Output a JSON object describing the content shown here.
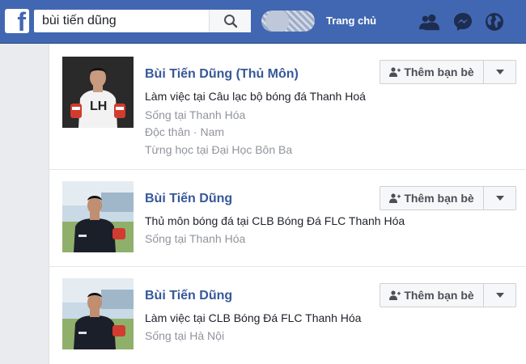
{
  "header": {
    "logo_letter": "f",
    "search_value": "bùi tiến dũng",
    "home_label": "Trang chủ",
    "icons": [
      "friend-requests-icon",
      "messenger-icon",
      "globe-icon"
    ]
  },
  "results": [
    {
      "name": "Bùi Tiến Dũng (Thủ Môn)",
      "lines": [
        "Làm việc tại Câu lạc bộ bóng đá Thanh Hoá",
        "Sống tại Thanh Hóa",
        "Độc thân · Nam",
        "Từng học tại Đại Học Bôn Ba"
      ],
      "button_label": "Thêm bạn bè"
    },
    {
      "name": "Bùi Tiến Dũng",
      "lines": [
        "Thủ môn bóng đá tại CLB Bóng Đá FLC Thanh Hóa",
        "Sống tại Thanh Hóa"
      ],
      "button_label": "Thêm bạn bè"
    },
    {
      "name": "Bùi Tiến Dũng",
      "lines": [
        "Làm việc tại CLB Bóng Đá FLC Thanh Hóa",
        "Sống tại Hà Nội"
      ],
      "button_label": "Thêm bạn bè"
    }
  ],
  "colors": {
    "brand": "#4267b2",
    "link": "#365899",
    "muted": "#90949c"
  }
}
